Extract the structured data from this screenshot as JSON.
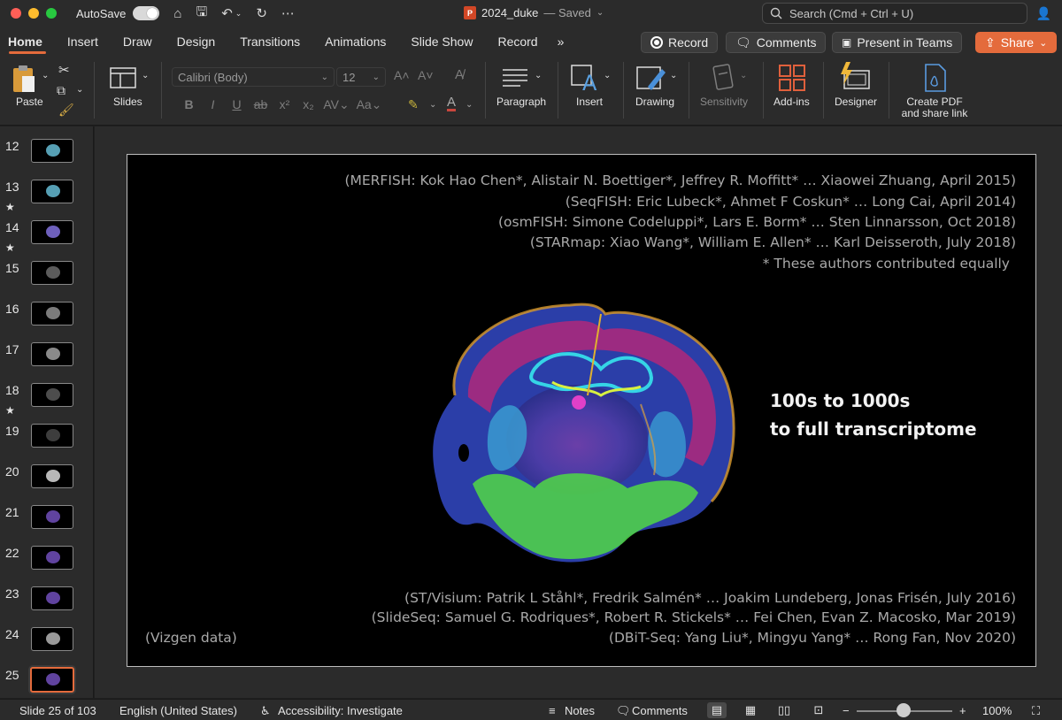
{
  "titlebar": {
    "autosave_label": "AutoSave",
    "doc_name": "2024_duke",
    "doc_status": "— Saved",
    "search_placeholder": "Search (Cmd + Ctrl + U)"
  },
  "tabs": [
    "Home",
    "Insert",
    "Draw",
    "Design",
    "Transitions",
    "Animations",
    "Slide Show",
    "Record"
  ],
  "tab_more": "»",
  "actions": {
    "record": "Record",
    "comments": "Comments",
    "present": "Present in Teams",
    "share": "Share"
  },
  "ribbon": {
    "paste": "Paste",
    "slides": "Slides",
    "font_name": "Calibri (Body)",
    "font_size": "12",
    "paragraph": "Paragraph",
    "insert": "Insert",
    "drawing": "Drawing",
    "sensitivity": "Sensitivity",
    "addins": "Add-ins",
    "designer": "Designer",
    "create_pdf_line1": "Create PDF",
    "create_pdf_line2": "and share link"
  },
  "thumbnails": [
    {
      "num": "12",
      "star": ""
    },
    {
      "num": "13",
      "star": ""
    },
    {
      "num": "14",
      "star": "★"
    },
    {
      "num": "15",
      "star": "★"
    },
    {
      "num": "16",
      "star": ""
    },
    {
      "num": "17",
      "star": ""
    },
    {
      "num": "18",
      "star": ""
    },
    {
      "num": "19",
      "star": "★"
    },
    {
      "num": "20",
      "star": ""
    },
    {
      "num": "21",
      "star": ""
    },
    {
      "num": "22",
      "star": ""
    },
    {
      "num": "23",
      "star": ""
    },
    {
      "num": "24",
      "star": ""
    },
    {
      "num": "25",
      "star": ""
    }
  ],
  "slide": {
    "citations_top": [
      "(MERFISH: Kok Hao Chen*, Alistair N. Boettiger*, Jeffrey R. Moffitt* … Xiaowei Zhuang, April 2015)",
      "(SeqFISH: Eric Lubeck*, Ahmet F Coskun* … Long Cai, April 2014)",
      "(osmFISH: Simone Codeluppi*, Lars E. Borm* … Sten Linnarsson, Oct 2018)",
      "(STARmap: Xiao Wang*, William E. Allen* … Karl Deisseroth, July 2018)",
      "* These authors contributed equally"
    ],
    "headline_line1": "100s to 1000s",
    "headline_line2": "to full transcriptome",
    "citations_bottom": [
      "(ST/Visium: Patrik L Ståhl*, Fredrik Salmén* … Joakim Lundeberg, Jonas Frisén, July 2016)",
      "(SlideSeq: Samuel G. Rodriques*, Robert R. Stickels* … Fei Chen, Evan Z. Macosko, Mar 2019)",
      "(DBiT-Seq: Yang Liu*, Mingyu Yang* … Rong Fan, Nov 2020)"
    ],
    "vizgen": "(Vizgen data)"
  },
  "status": {
    "slide_counter": "Slide 25 of 103",
    "language": "English (United States)",
    "accessibility": "Accessibility: Investigate",
    "notes": "Notes",
    "comments": "Comments",
    "zoom": "100%"
  },
  "colors": {
    "accent": "#e46b3c",
    "chrome": "#2b2b2b"
  }
}
